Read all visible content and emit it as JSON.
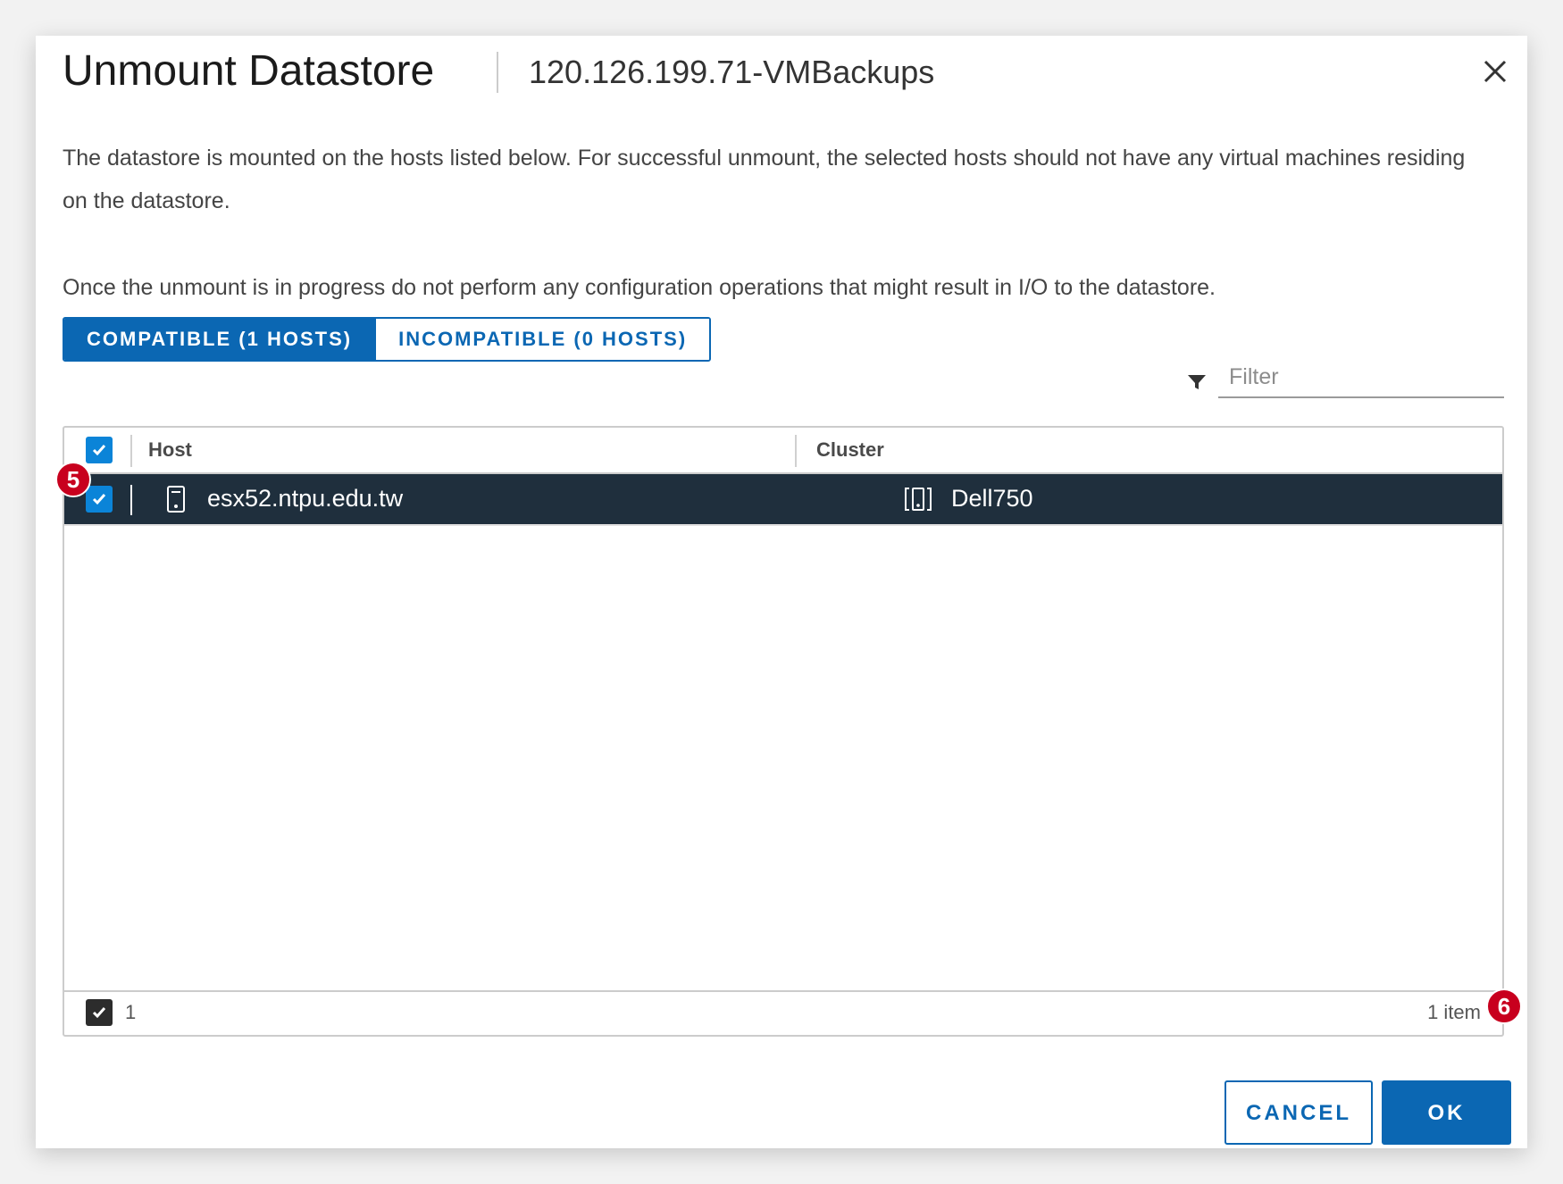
{
  "dialog": {
    "title": "Unmount Datastore",
    "subtitle": "120.126.199.71-VMBackups"
  },
  "description": {
    "line1": "The datastore is mounted on the hosts listed below. For successful unmount, the selected hosts should not have any virtual machines residing on the datastore.",
    "line2": "Once the unmount is in progress do not perform any configuration operations that might result in I/O to the datastore."
  },
  "tabs": [
    {
      "label": "COMPATIBLE (1 HOSTS)",
      "active": true
    },
    {
      "label": "INCOMPATIBLE (0 HOSTS)",
      "active": false
    }
  ],
  "filter": {
    "placeholder": "Filter"
  },
  "grid": {
    "columns": [
      "Host",
      "Cluster"
    ],
    "rows": [
      {
        "host": "esx52.ntpu.edu.tw",
        "cluster": "Dell750",
        "selected": true
      }
    ],
    "footer": {
      "selected_count": "1",
      "total": "1 item"
    }
  },
  "badges": {
    "step5": "5",
    "step6": "6"
  },
  "buttons": {
    "cancel": "CANCEL",
    "ok": "OK"
  },
  "colors": {
    "primary": "#0b67b3",
    "checkbox": "#0b84d8",
    "selected_row": "#1f2f3d",
    "badge": "#c8001e"
  }
}
